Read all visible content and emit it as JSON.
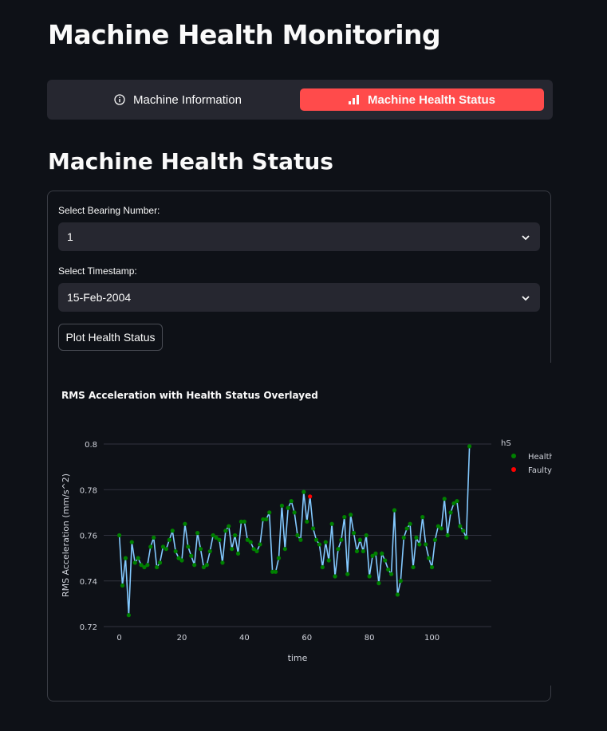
{
  "app": {
    "title": "Machine Health Monitoring"
  },
  "tabs": [
    {
      "label": "Machine Information",
      "icon": "info-circle-icon",
      "active": false
    },
    {
      "label": "Machine Health Status",
      "icon": "bar-chart-icon",
      "active": true
    }
  ],
  "section": {
    "title": "Machine Health Status"
  },
  "form": {
    "bearing_label": "Select Bearing Number:",
    "bearing_value": "1",
    "timestamp_label": "Select Timestamp:",
    "timestamp_value": "15-Feb-2004",
    "submit_label": "Plot Health Status"
  },
  "colors": {
    "background": "#0e1117",
    "surface": "#262730",
    "accent": "#ff4b4b",
    "line": "#83c9ff",
    "healthy": "#008000",
    "faulty": "#ff0000"
  },
  "chart_data": {
    "type": "line",
    "title": "RMS Acceleration with Health Status Overlayed",
    "xlabel": "time",
    "ylabel": "RMS Acceleration (mm/s^2)",
    "xlim": [
      -5,
      119
    ],
    "ylim": [
      0.72,
      0.8
    ],
    "xticks": [
      0,
      20,
      40,
      60,
      80,
      100
    ],
    "yticks": [
      0.72,
      0.74,
      0.76,
      0.78,
      0.8
    ],
    "grid": true,
    "legend": {
      "title": "hS",
      "position": "right"
    },
    "series": [
      {
        "name": "RMS Acceleration",
        "x": [
          0,
          1,
          2,
          3,
          4,
          5,
          6,
          7,
          8,
          9,
          10,
          11,
          12,
          13,
          14,
          15,
          16,
          17,
          18,
          19,
          20,
          21,
          22,
          23,
          24,
          25,
          26,
          27,
          28,
          29,
          30,
          31,
          32,
          33,
          34,
          35,
          36,
          37,
          38,
          39,
          40,
          41,
          42,
          43,
          44,
          45,
          46,
          47,
          48,
          49,
          50,
          51,
          52,
          53,
          54,
          55,
          56,
          57,
          58,
          59,
          60,
          61,
          62,
          63,
          64,
          65,
          66,
          67,
          68,
          69,
          70,
          71,
          72,
          73,
          74,
          75,
          76,
          77,
          78,
          79,
          80,
          81,
          82,
          83,
          84,
          85,
          86,
          87,
          88,
          89,
          90,
          91,
          92,
          93,
          94,
          95,
          96,
          97,
          98,
          99,
          100,
          101,
          102,
          103,
          104,
          105,
          106,
          107,
          108,
          109,
          110,
          111,
          112
        ],
        "y": [
          0.76,
          0.738,
          0.75,
          0.725,
          0.757,
          0.748,
          0.75,
          0.747,
          0.746,
          0.747,
          0.755,
          0.759,
          0.746,
          0.748,
          0.755,
          0.754,
          0.758,
          0.762,
          0.753,
          0.75,
          0.749,
          0.765,
          0.755,
          0.751,
          0.747,
          0.761,
          0.754,
          0.746,
          0.747,
          0.753,
          0.76,
          0.759,
          0.758,
          0.748,
          0.762,
          0.764,
          0.754,
          0.76,
          0.752,
          0.766,
          0.766,
          0.758,
          0.757,
          0.754,
          0.753,
          0.756,
          0.767,
          0.767,
          0.77,
          0.744,
          0.744,
          0.75,
          0.773,
          0.754,
          0.772,
          0.775,
          0.77,
          0.76,
          0.758,
          0.779,
          0.766,
          0.777,
          0.763,
          0.758,
          0.756,
          0.746,
          0.757,
          0.749,
          0.765,
          0.742,
          0.754,
          0.758,
          0.768,
          0.743,
          0.769,
          0.761,
          0.753,
          0.758,
          0.753,
          0.76,
          0.742,
          0.751,
          0.752,
          0.739,
          0.752,
          0.749,
          0.745,
          0.743,
          0.771,
          0.734,
          0.74,
          0.759,
          0.763,
          0.765,
          0.746,
          0.759,
          0.756,
          0.768,
          0.756,
          0.75,
          0.746,
          0.758,
          0.764,
          0.763,
          0.776,
          0.76,
          0.77,
          0.774,
          0.775,
          0.764,
          0.762,
          0.759,
          0.799
        ],
        "status": [
          "Healthy",
          "Healthy",
          "Healthy",
          "Healthy",
          "Healthy",
          "Healthy",
          "Healthy",
          "Healthy",
          "Healthy",
          "Healthy",
          "Healthy",
          "Healthy",
          "Healthy",
          "Healthy",
          "Healthy",
          "Healthy",
          "Healthy",
          "Healthy",
          "Healthy",
          "Healthy",
          "Healthy",
          "Healthy",
          "Healthy",
          "Healthy",
          "Healthy",
          "Healthy",
          "Healthy",
          "Healthy",
          "Healthy",
          "Healthy",
          "Healthy",
          "Healthy",
          "Healthy",
          "Healthy",
          "Healthy",
          "Healthy",
          "Healthy",
          "Healthy",
          "Healthy",
          "Healthy",
          "Healthy",
          "Healthy",
          "Healthy",
          "Healthy",
          "Healthy",
          "Healthy",
          "Healthy",
          "Healthy",
          "Healthy",
          "Healthy",
          "Healthy",
          "Healthy",
          "Healthy",
          "Healthy",
          "Healthy",
          "Healthy",
          "Healthy",
          "Healthy",
          "Healthy",
          "Healthy",
          "Healthy",
          "Faulty",
          "Healthy",
          "Healthy",
          "Healthy",
          "Healthy",
          "Healthy",
          "Healthy",
          "Healthy",
          "Healthy",
          "Healthy",
          "Healthy",
          "Healthy",
          "Healthy",
          "Healthy",
          "Healthy",
          "Healthy",
          "Healthy",
          "Healthy",
          "Healthy",
          "Healthy",
          "Healthy",
          "Healthy",
          "Healthy",
          "Healthy",
          "Healthy",
          "Healthy",
          "Healthy",
          "Healthy",
          "Healthy",
          "Healthy",
          "Healthy",
          "Healthy",
          "Healthy",
          "Healthy",
          "Healthy",
          "Healthy",
          "Healthy",
          "Healthy",
          "Healthy",
          "Healthy",
          "Healthy",
          "Healthy",
          "Healthy",
          "Healthy",
          "Healthy",
          "Healthy",
          "Healthy",
          "Healthy",
          "Healthy",
          "Healthy",
          "Healthy",
          "Healthy"
        ]
      },
      {
        "name": "Healthy",
        "color": "#008000"
      },
      {
        "name": "Faulty",
        "color": "#ff0000"
      }
    ]
  }
}
